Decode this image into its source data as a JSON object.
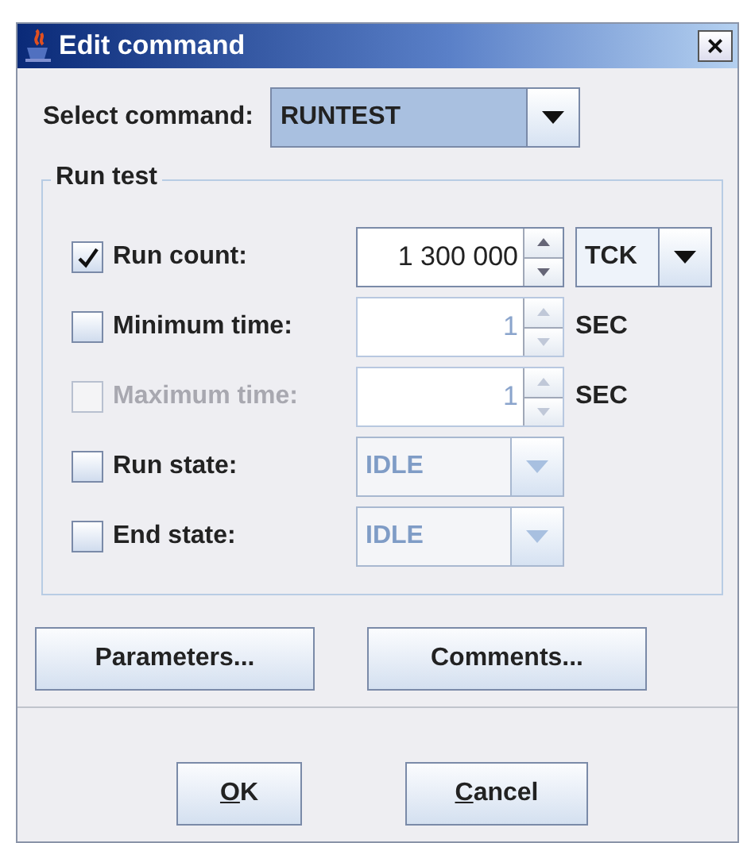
{
  "window": {
    "title": "Edit command",
    "close": "×"
  },
  "select_command": {
    "label": "Select command:",
    "value": "RUNTEST"
  },
  "group": {
    "title": "Run test",
    "rows": [
      {
        "kind": "spinner",
        "label": "Run count:",
        "checked": true,
        "disabled": false,
        "field_disabled": false,
        "value": "1 300 000",
        "unit": {
          "kind": "combo",
          "text": "TCK"
        }
      },
      {
        "kind": "spinner",
        "label": "Minimum time:",
        "checked": false,
        "disabled": false,
        "field_disabled": true,
        "value": "1",
        "unit": {
          "kind": "text",
          "text": "SEC"
        }
      },
      {
        "kind": "spinner",
        "label": "Maximum time:",
        "checked": false,
        "disabled": true,
        "field_disabled": true,
        "value": "1",
        "unit": {
          "kind": "text",
          "text": "SEC"
        }
      },
      {
        "kind": "combo",
        "label": "Run state:",
        "checked": false,
        "disabled": false,
        "field_disabled": true,
        "value": "IDLE"
      },
      {
        "kind": "combo",
        "label": "End state:",
        "checked": false,
        "disabled": false,
        "field_disabled": true,
        "value": "IDLE"
      }
    ]
  },
  "actions": [
    "Parameters...",
    "Comments..."
  ],
  "buttons": [
    {
      "label": "OK",
      "mnemonic": true
    },
    {
      "label": "Cancel",
      "mnemonic": true
    }
  ]
}
